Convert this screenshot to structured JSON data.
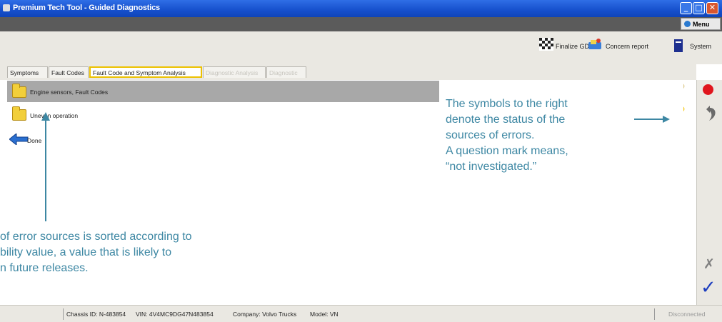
{
  "window": {
    "title": "Premium Tech Tool - Guided Diagnostics",
    "minimize_glyph": "_",
    "maximize_glyph": "□",
    "close_glyph": "✕"
  },
  "menu": {
    "label": "Menu"
  },
  "toolbar": {
    "finalize_label": "Finalize GDR",
    "concern_label": "Concern report",
    "system_label": "System"
  },
  "tabs": [
    {
      "label": "Symptoms",
      "state": "normal"
    },
    {
      "label": "Fault Codes",
      "state": "normal"
    },
    {
      "label": "Fault Code and Symptom Analysis",
      "state": "active"
    },
    {
      "label": "Diagnostic Analysis",
      "state": "disabled"
    },
    {
      "label": "Diagnostic",
      "state": "disabled"
    }
  ],
  "list": {
    "items": [
      {
        "label": "Engine sensors, Fault Codes",
        "status_icon": "question-icon"
      },
      {
        "label": "Uneven operation",
        "status_icon": "question-icon"
      }
    ],
    "done_label": "Done"
  },
  "side_icons": [
    "record-icon",
    "undo-icon",
    "cancel-icon",
    "confirm-icon"
  ],
  "side_glyphs": {
    "cancel": "✗",
    "confirm": "✓"
  },
  "status_question_glyph": "?",
  "annotations": {
    "right": [
      "The symbols to the right",
      "denote the status of the",
      "sources of errors.",
      "A question mark means,",
      "“not investigated.”"
    ],
    "left": [
      "of error sources is sorted according to",
      "bility value, a value that is likely to",
      "n future releases."
    ]
  },
  "statusbar": {
    "chassis": "Chassis ID: N-483854",
    "vin": "VIN: 4V4MC9DG47N483854",
    "company": "Company: Volvo Trucks",
    "model": "Model: VN",
    "connection": "Disconnected"
  },
  "colors": {
    "titlebar": "#1650cc",
    "annotation_text": "#3d87a3",
    "active_tab_border": "#ecc100",
    "question_mark": "#f4c712",
    "record_dot": "#e0151d",
    "confirm_check": "#1f3fbf"
  }
}
